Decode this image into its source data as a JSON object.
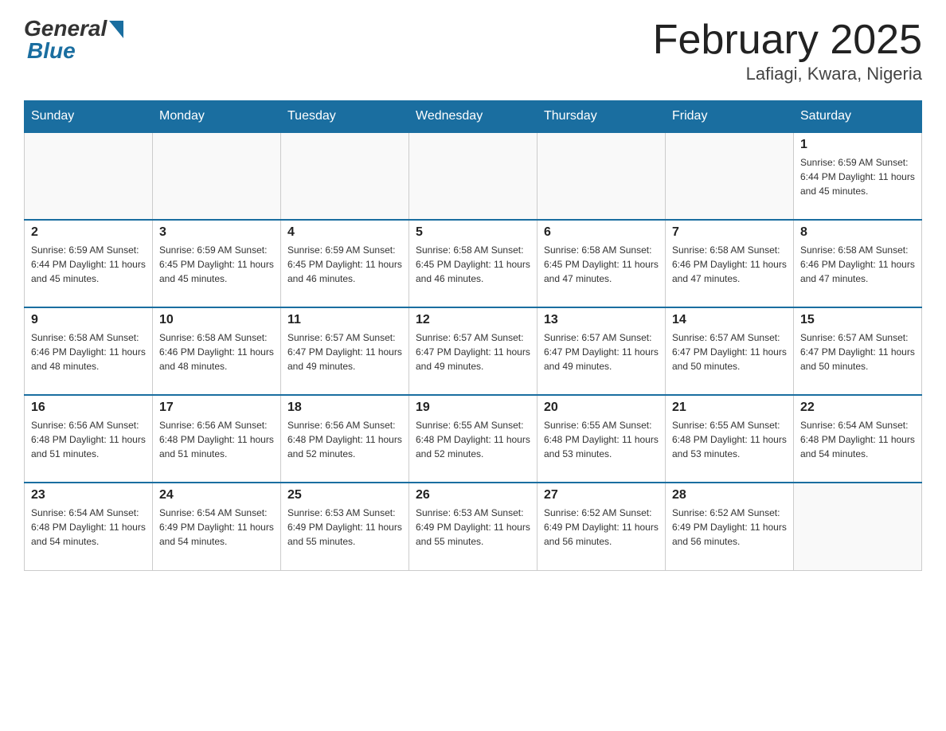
{
  "logo": {
    "general": "General",
    "blue": "Blue"
  },
  "title": "February 2025",
  "location": "Lafiagi, Kwara, Nigeria",
  "days_of_week": [
    "Sunday",
    "Monday",
    "Tuesday",
    "Wednesday",
    "Thursday",
    "Friday",
    "Saturday"
  ],
  "weeks": [
    [
      {
        "day": "",
        "info": ""
      },
      {
        "day": "",
        "info": ""
      },
      {
        "day": "",
        "info": ""
      },
      {
        "day": "",
        "info": ""
      },
      {
        "day": "",
        "info": ""
      },
      {
        "day": "",
        "info": ""
      },
      {
        "day": "1",
        "info": "Sunrise: 6:59 AM\nSunset: 6:44 PM\nDaylight: 11 hours\nand 45 minutes."
      }
    ],
    [
      {
        "day": "2",
        "info": "Sunrise: 6:59 AM\nSunset: 6:44 PM\nDaylight: 11 hours\nand 45 minutes."
      },
      {
        "day": "3",
        "info": "Sunrise: 6:59 AM\nSunset: 6:45 PM\nDaylight: 11 hours\nand 45 minutes."
      },
      {
        "day": "4",
        "info": "Sunrise: 6:59 AM\nSunset: 6:45 PM\nDaylight: 11 hours\nand 46 minutes."
      },
      {
        "day": "5",
        "info": "Sunrise: 6:58 AM\nSunset: 6:45 PM\nDaylight: 11 hours\nand 46 minutes."
      },
      {
        "day": "6",
        "info": "Sunrise: 6:58 AM\nSunset: 6:45 PM\nDaylight: 11 hours\nand 47 minutes."
      },
      {
        "day": "7",
        "info": "Sunrise: 6:58 AM\nSunset: 6:46 PM\nDaylight: 11 hours\nand 47 minutes."
      },
      {
        "day": "8",
        "info": "Sunrise: 6:58 AM\nSunset: 6:46 PM\nDaylight: 11 hours\nand 47 minutes."
      }
    ],
    [
      {
        "day": "9",
        "info": "Sunrise: 6:58 AM\nSunset: 6:46 PM\nDaylight: 11 hours\nand 48 minutes."
      },
      {
        "day": "10",
        "info": "Sunrise: 6:58 AM\nSunset: 6:46 PM\nDaylight: 11 hours\nand 48 minutes."
      },
      {
        "day": "11",
        "info": "Sunrise: 6:57 AM\nSunset: 6:47 PM\nDaylight: 11 hours\nand 49 minutes."
      },
      {
        "day": "12",
        "info": "Sunrise: 6:57 AM\nSunset: 6:47 PM\nDaylight: 11 hours\nand 49 minutes."
      },
      {
        "day": "13",
        "info": "Sunrise: 6:57 AM\nSunset: 6:47 PM\nDaylight: 11 hours\nand 49 minutes."
      },
      {
        "day": "14",
        "info": "Sunrise: 6:57 AM\nSunset: 6:47 PM\nDaylight: 11 hours\nand 50 minutes."
      },
      {
        "day": "15",
        "info": "Sunrise: 6:57 AM\nSunset: 6:47 PM\nDaylight: 11 hours\nand 50 minutes."
      }
    ],
    [
      {
        "day": "16",
        "info": "Sunrise: 6:56 AM\nSunset: 6:48 PM\nDaylight: 11 hours\nand 51 minutes."
      },
      {
        "day": "17",
        "info": "Sunrise: 6:56 AM\nSunset: 6:48 PM\nDaylight: 11 hours\nand 51 minutes."
      },
      {
        "day": "18",
        "info": "Sunrise: 6:56 AM\nSunset: 6:48 PM\nDaylight: 11 hours\nand 52 minutes."
      },
      {
        "day": "19",
        "info": "Sunrise: 6:55 AM\nSunset: 6:48 PM\nDaylight: 11 hours\nand 52 minutes."
      },
      {
        "day": "20",
        "info": "Sunrise: 6:55 AM\nSunset: 6:48 PM\nDaylight: 11 hours\nand 53 minutes."
      },
      {
        "day": "21",
        "info": "Sunrise: 6:55 AM\nSunset: 6:48 PM\nDaylight: 11 hours\nand 53 minutes."
      },
      {
        "day": "22",
        "info": "Sunrise: 6:54 AM\nSunset: 6:48 PM\nDaylight: 11 hours\nand 54 minutes."
      }
    ],
    [
      {
        "day": "23",
        "info": "Sunrise: 6:54 AM\nSunset: 6:48 PM\nDaylight: 11 hours\nand 54 minutes."
      },
      {
        "day": "24",
        "info": "Sunrise: 6:54 AM\nSunset: 6:49 PM\nDaylight: 11 hours\nand 54 minutes."
      },
      {
        "day": "25",
        "info": "Sunrise: 6:53 AM\nSunset: 6:49 PM\nDaylight: 11 hours\nand 55 minutes."
      },
      {
        "day": "26",
        "info": "Sunrise: 6:53 AM\nSunset: 6:49 PM\nDaylight: 11 hours\nand 55 minutes."
      },
      {
        "day": "27",
        "info": "Sunrise: 6:52 AM\nSunset: 6:49 PM\nDaylight: 11 hours\nand 56 minutes."
      },
      {
        "day": "28",
        "info": "Sunrise: 6:52 AM\nSunset: 6:49 PM\nDaylight: 11 hours\nand 56 minutes."
      },
      {
        "day": "",
        "info": ""
      }
    ]
  ]
}
